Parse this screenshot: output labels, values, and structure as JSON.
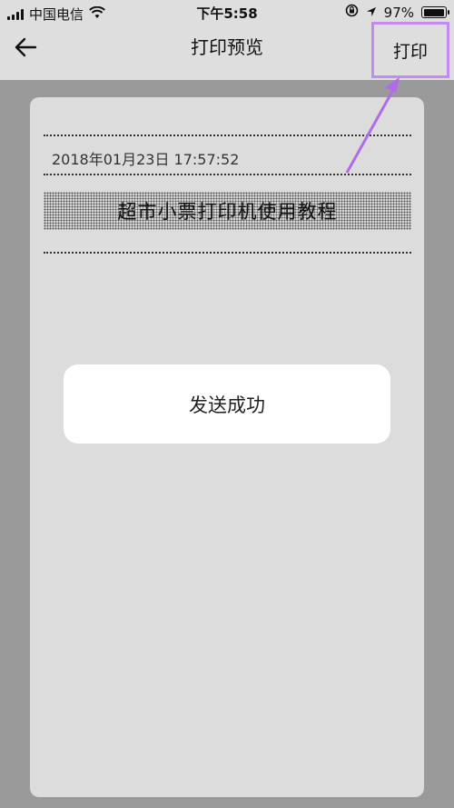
{
  "status_bar": {
    "carrier": "中国电信",
    "time": "下午5:58",
    "battery_percent": "97%",
    "battery_level": 0.97
  },
  "navbar": {
    "title": "打印预览",
    "print_label": "打印",
    "back_icon": "arrow-left-icon"
  },
  "receipt": {
    "timestamp": "2018年01月23日 17:57:52",
    "title": "超市小票打印机使用教程"
  },
  "toast": {
    "message": "发送成功"
  },
  "colors": {
    "highlight": "#c58af0",
    "annotation_arrow": "#b06ce8"
  }
}
